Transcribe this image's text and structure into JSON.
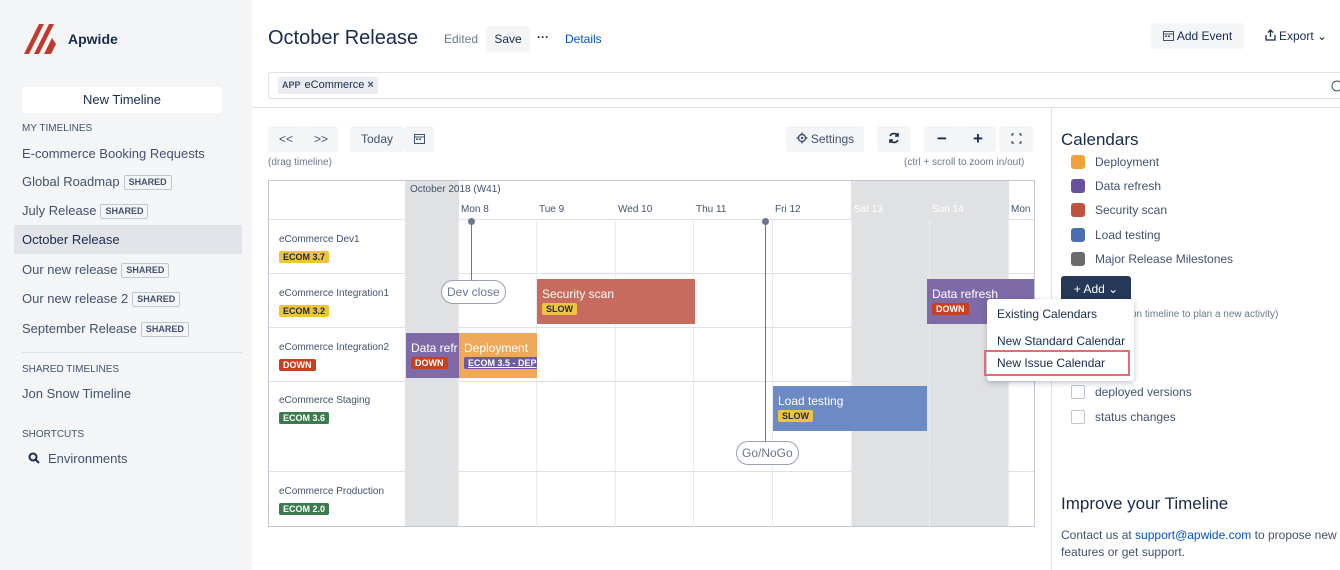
{
  "brand": {
    "name": "Apwide"
  },
  "sidebar": {
    "new_timeline": "New Timeline",
    "my_timelines_label": "MY TIMELINES",
    "my_timelines": [
      {
        "label": "E-commerce Booking Requests",
        "shared": ""
      },
      {
        "label": "Global Roadmap",
        "shared": "SHARED"
      },
      {
        "label": "July Release",
        "shared": "SHARED"
      },
      {
        "label": "October Release",
        "shared": "",
        "active": true
      },
      {
        "label": "Our new release",
        "shared": "SHARED"
      },
      {
        "label": "Our new release 2",
        "shared": "SHARED"
      },
      {
        "label": "September Release",
        "shared": "SHARED"
      }
    ],
    "shared_label": "SHARED TIMELINES",
    "shared_timelines": [
      {
        "label": "Jon Snow Timeline"
      }
    ],
    "shortcuts_label": "SHORTCUTS",
    "shortcuts": [
      {
        "label": "Environments",
        "icon": "search-icon"
      }
    ]
  },
  "header": {
    "title": "October Release",
    "edited": "Edited",
    "save": "Save",
    "more": "···",
    "details": "Details",
    "add_event": "Add Event",
    "export": "Export"
  },
  "filter": {
    "chip_type": "APP",
    "chip_label": "eCommerce",
    "chip_remove": "×"
  },
  "toolbar": {
    "prev": "<<",
    "next": ">>",
    "today": "Today",
    "drag_hint": "(drag timeline)",
    "settings": "Settings",
    "zoom_out": "−",
    "zoom_in": "+",
    "zoom_hint": "(ctrl + scroll to zoom in/out)"
  },
  "timeline": {
    "week_label": "October 2018 (W41)",
    "days": [
      "Mon 8",
      "Tue 9",
      "Wed 10",
      "Thu 11",
      "Fri 12",
      "Sat 13",
      "Sun 14",
      "Mon"
    ],
    "rows": [
      {
        "name": "eCommerce Dev1",
        "badge": "ECOM 3.7",
        "badge_color": "#f0c33c",
        "badge_text": "#172b4d"
      },
      {
        "name": "eCommerce Integration1",
        "badge": "ECOM 3.2",
        "badge_color": "#f0c33c",
        "badge_text": "#172b4d"
      },
      {
        "name": "eCommerce Integration2",
        "badge": "DOWN",
        "badge_color": "#c8401f",
        "badge_text": "#ffffff"
      },
      {
        "name": "eCommerce Staging",
        "badge": "ECOM 3.6",
        "badge_color": "#3d7b4f",
        "badge_text": "#ffffff"
      },
      {
        "name": "eCommerce Production",
        "badge": "ECOM 2.0",
        "badge_color": "#3d7b4f",
        "badge_text": "#ffffff"
      }
    ],
    "events": [
      {
        "label": "Security scan",
        "badge": "SLOW"
      },
      {
        "label": "Data refresh",
        "badge": "DOWN"
      },
      {
        "label": "Data refr",
        "badge": "DOWN"
      },
      {
        "label": "Deployment",
        "badge": "ECOM 3.5 - DEP"
      },
      {
        "label": "Load testing",
        "badge": "SLOW"
      }
    ],
    "milestones": [
      {
        "label": "Dev close"
      },
      {
        "label": "Go/NoGo"
      }
    ]
  },
  "calendars": {
    "title": "Calendars",
    "items": [
      {
        "label": "Deployment",
        "color": "#f0a23a"
      },
      {
        "label": "Data refresh",
        "color": "#6a4f9c"
      },
      {
        "label": "Security scan",
        "color": "#c0533f"
      },
      {
        "label": "Load testing",
        "color": "#4a6fb0"
      },
      {
        "label": "Major Release Milestones",
        "color": "#6b6b6b"
      }
    ],
    "add": "+ Add ⌄",
    "add_hint": "on timeline to plan a new activity)",
    "checkboxes": [
      {
        "label": "deployed versions"
      },
      {
        "label": "status changes"
      }
    ],
    "dropdown": [
      "Existing Calendars",
      "New Standard Calendar",
      "New Issue Calendar"
    ]
  },
  "improve": {
    "title": "Improve your Timeline",
    "text_before": "Contact us at ",
    "link": "support@apwide.com",
    "text_after": " to propose new features or get support."
  }
}
